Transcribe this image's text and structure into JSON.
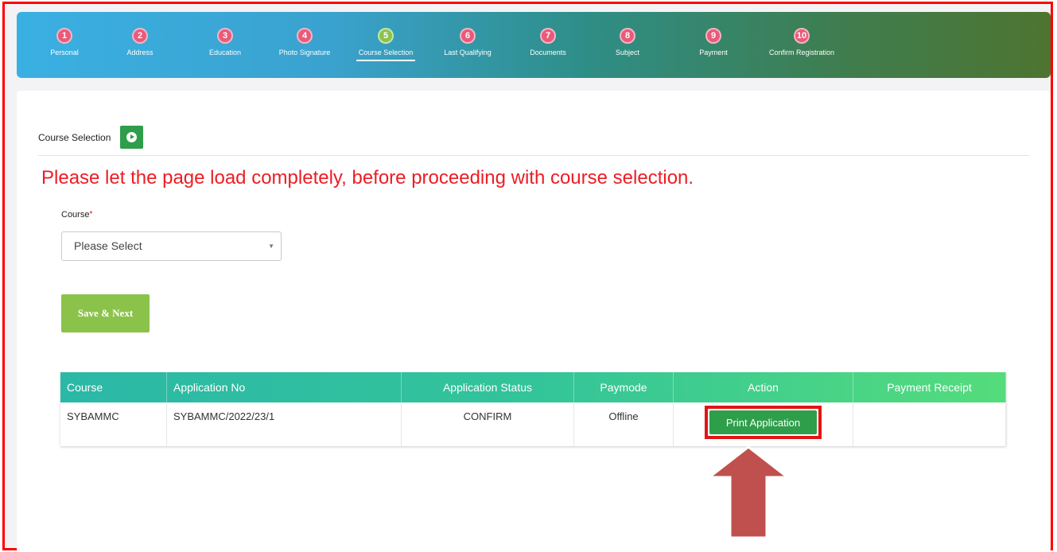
{
  "steps": [
    {
      "num": "1",
      "label": "Personal"
    },
    {
      "num": "2",
      "label": "Address"
    },
    {
      "num": "3",
      "label": "Education"
    },
    {
      "num": "4",
      "label": "Photo Signature"
    },
    {
      "num": "5",
      "label": "Course Selection",
      "active": true
    },
    {
      "num": "6",
      "label": "Last Qualifying"
    },
    {
      "num": "7",
      "label": "Documents"
    },
    {
      "num": "8",
      "label": "Subject"
    },
    {
      "num": "9",
      "label": "Payment"
    },
    {
      "num": "10",
      "label": "Confirm Registration"
    }
  ],
  "section": {
    "title": "Course Selection",
    "warning": "Please let the page load completely, before proceeding with course selection."
  },
  "form": {
    "course_label": "Course",
    "required_mark": "*",
    "course_select": {
      "selected": "Please Select"
    },
    "save_label": "Save & Next"
  },
  "table": {
    "headers": [
      "Course",
      "Application No",
      "Application Status",
      "Paymode",
      "Action",
      "Payment Receipt"
    ],
    "rows": [
      {
        "course": "SYBAMMC",
        "application_no": "SYBAMMC/2022/23/1",
        "status": "CONFIRM",
        "paymode": "Offline",
        "action_label": "Print Application",
        "payment_receipt": ""
      }
    ]
  },
  "colors": {
    "highlight": "#e21414",
    "button_green": "#2e9e4a",
    "save_green": "#8bc34a",
    "arrow": "#c0504d"
  }
}
